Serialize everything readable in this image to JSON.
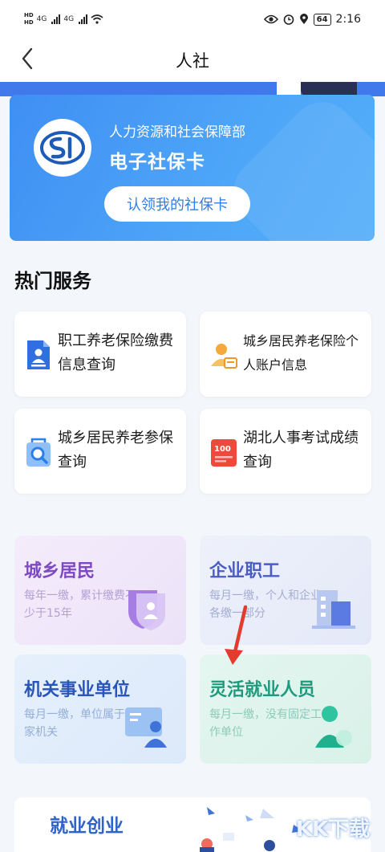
{
  "status_bar": {
    "sim1": "HD",
    "sim2": "HD",
    "net1": "4G",
    "net2": "4G",
    "battery": "64",
    "time": "2:16"
  },
  "nav": {
    "title": "人社"
  },
  "card": {
    "subtitle": "人力资源和社会保障部",
    "title": "电子社保卡",
    "button": "认领我的社保卡"
  },
  "hot_services": {
    "title": "热门服务",
    "items": [
      {
        "label": "职工养老保险缴费信息查询",
        "icon": "document-person-icon"
      },
      {
        "label": "城乡居民养老保险个人账户信息",
        "icon": "person-card-icon"
      },
      {
        "label": "城乡居民养老参保查询",
        "icon": "search-bag-icon"
      },
      {
        "label": "湖北人事考试成绩查询",
        "icon": "score-100-icon"
      }
    ]
  },
  "categories": [
    {
      "title": "城乡居民",
      "desc": "每年一缴，累计缴费不少于15年",
      "color": "#7e4ac4"
    },
    {
      "title": "企业职工",
      "desc": "每月一缴，个人和企业各缴一部分",
      "color": "#4b5cc4"
    },
    {
      "title": "机关事业单位",
      "desc": "每月一缴，单位属于国家机关",
      "color": "#2a55b8"
    },
    {
      "title": "灵活就业人员",
      "desc": "每月一缴，没有固定工作单位",
      "color": "#1e9a7c"
    }
  ],
  "bottom": {
    "title": "就业创业"
  },
  "watermark": "KK下载"
}
